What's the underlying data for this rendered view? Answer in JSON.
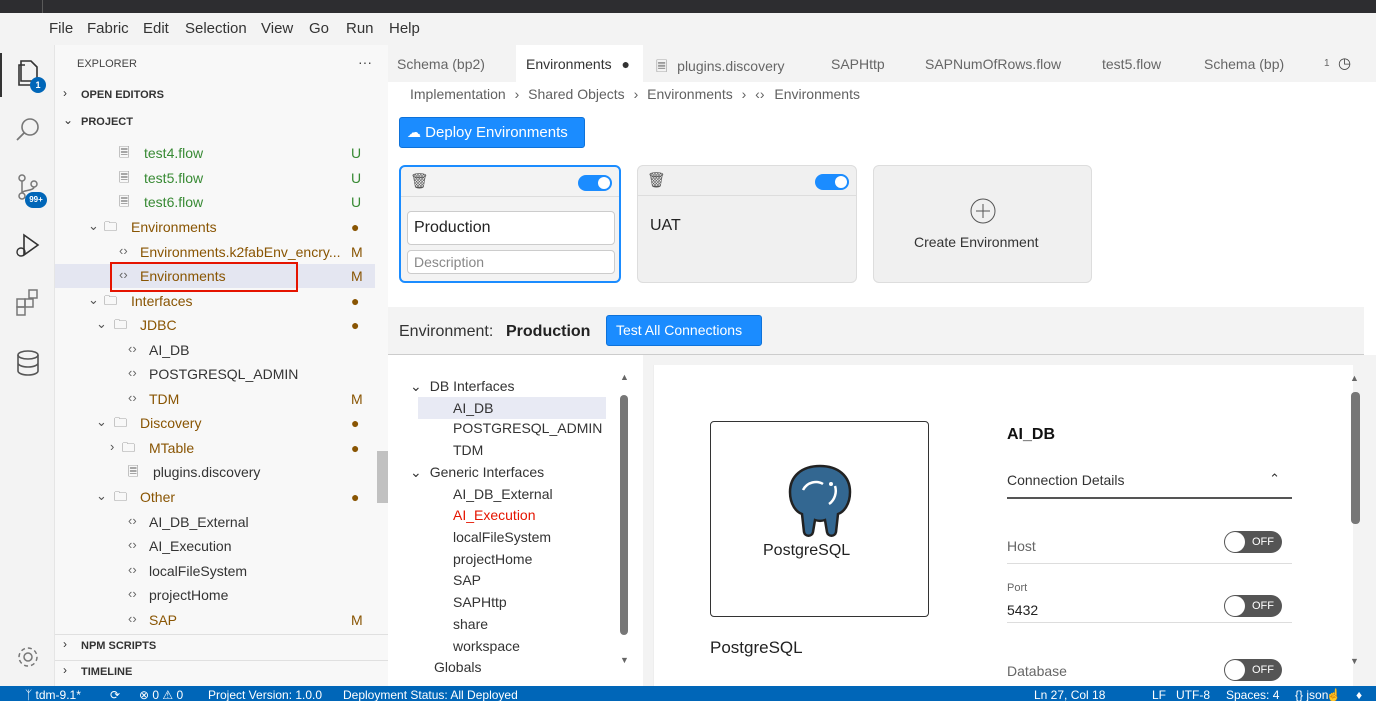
{
  "menu": [
    "File",
    "Fabric",
    "Edit",
    "Selection",
    "View",
    "Go",
    "Run",
    "Help"
  ],
  "activity": {
    "explorer_badge": "1",
    "scm_badge": "99+"
  },
  "sidebar": {
    "title": "EXPLORER",
    "more": "···",
    "sections": {
      "open_editors": "OPEN EDITORS",
      "project": "PROJECT",
      "npm_scripts": "NPM SCRIPTS",
      "timeline": "TIMELINE"
    },
    "tree": [
      {
        "label": "test4.flow",
        "status": "U"
      },
      {
        "label": "test5.flow",
        "status": "U"
      },
      {
        "label": "test6.flow",
        "status": "U"
      },
      {
        "label": "Environments",
        "status": "●"
      },
      {
        "label": "Environments.k2fabEnv_encry...",
        "status": "M"
      },
      {
        "label": "Environments",
        "status": "M"
      },
      {
        "label": "Interfaces",
        "status": "●"
      },
      {
        "label": "JDBC",
        "status": "●"
      },
      {
        "label": "AI_DB",
        "status": ""
      },
      {
        "label": "POSTGRESQL_ADMIN",
        "status": ""
      },
      {
        "label": "TDM",
        "status": "M"
      },
      {
        "label": "Discovery",
        "status": "●"
      },
      {
        "label": "MTable",
        "status": "●"
      },
      {
        "label": "plugins.discovery",
        "status": ""
      },
      {
        "label": "Other",
        "status": "●"
      },
      {
        "label": "AI_DB_External",
        "status": ""
      },
      {
        "label": "AI_Execution",
        "status": ""
      },
      {
        "label": "localFileSystem",
        "status": ""
      },
      {
        "label": "projectHome",
        "status": ""
      },
      {
        "label": "SAP",
        "status": "M"
      }
    ]
  },
  "tabs": [
    "Schema (bp2)",
    "Environments",
    "plugins.discovery",
    "SAPHttp",
    "SAPNumOfRows.flow",
    "test5.flow",
    "Schema (bp)",
    "1"
  ],
  "breadcrumb": [
    "Implementation",
    "Shared Objects",
    "Environments",
    "Environments"
  ],
  "deploy_button": "Deploy Environments",
  "env_cards": {
    "production_name": "Production",
    "production_desc_placeholder": "Description",
    "uat_name": "UAT",
    "create_label": "Create Environment"
  },
  "env_bar": {
    "label": "Environment:",
    "value": "Production",
    "test_button": "Test All Connections"
  },
  "interface_tree": {
    "db_group": "DB Interfaces",
    "db_items": [
      "AI_DB",
      "POSTGRESQL_ADMIN",
      "TDM"
    ],
    "generic_group": "Generic Interfaces",
    "generic_items": [
      "AI_DB_External",
      "AI_Execution",
      "localFileSystem",
      "projectHome",
      "SAP",
      "SAPHttp",
      "share",
      "workspace"
    ],
    "globals": "Globals"
  },
  "details": {
    "logo_text": "PostgreSQL",
    "caption": "PostgreSQL",
    "name": "AI_DB",
    "section": "Connection Details",
    "host_label": "Host",
    "port_label": "Port",
    "port_value": "5432",
    "database_label": "Database",
    "off": "OFF"
  },
  "statusbar": {
    "branch": "tdm-9.1*",
    "problems": "⊗ 0 ⚠ 0",
    "version": "Project Version: 1.0.0",
    "deploy_status": "Deployment Status: All Deployed",
    "position": "Ln 27, Col 18",
    "eol": "LF",
    "encoding": "UTF-8",
    "spaces": "Spaces: 4",
    "lang": "{} json"
  },
  "colors": {
    "accent": "#1b8cff",
    "status_bar": "#0066b8",
    "untracked_green": "#388a34",
    "modified_orange": "#895503",
    "highlight_red": "#e51400"
  }
}
